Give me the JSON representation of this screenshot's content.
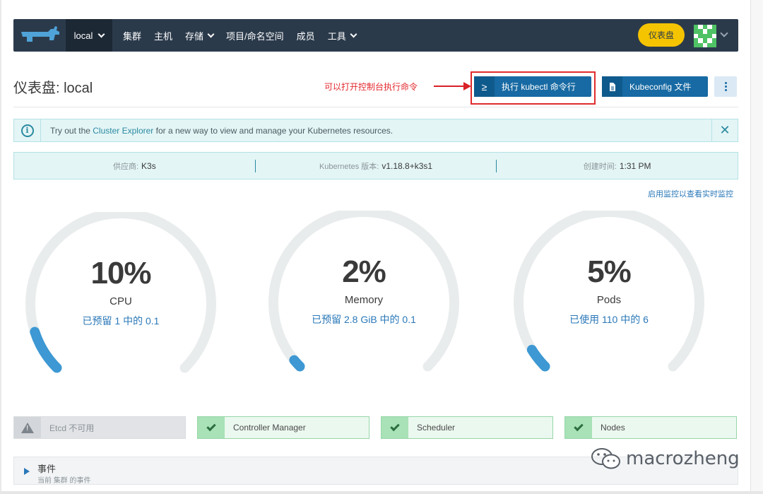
{
  "header": {
    "cluster": "local",
    "nav": [
      "集群",
      "主机",
      "存储",
      "项目/命名空间",
      "成员",
      "工具"
    ],
    "dashboard_button": "仪表盘"
  },
  "page": {
    "title": "仪表盘: local",
    "annotation": "可以打开控制台执行命令",
    "kubectl_button": "执行 kubectl 命令行",
    "kubeconfig_button": "Kubeconfig 文件"
  },
  "banner": {
    "before": "Try out the ",
    "link": "Cluster Explorer",
    "after": " for a new way to view and manage your Kubernetes resources."
  },
  "info": {
    "provider_label": "供应商:",
    "provider_value": "K3s",
    "k8s_label": "Kubernetes 版本:",
    "k8s_value": "v1.18.8+k3s1",
    "created_label": "创建时间:",
    "created_value": "1:31 PM"
  },
  "monitor_link": "启用监控以查看实时监控",
  "gauges": [
    {
      "percent_label": "10%",
      "name": "CPU",
      "detail": "已预留 1 中的 0.1",
      "fraction": 0.1
    },
    {
      "percent_label": "2%",
      "name": "Memory",
      "detail": "已预留 2.8 GiB 中的 0.1",
      "fraction": 0.02
    },
    {
      "percent_label": "5%",
      "name": "Pods",
      "detail": "已使用 110 中的 6",
      "fraction": 0.05
    }
  ],
  "components": [
    {
      "name": "Etcd 不可用",
      "status": "unavailable"
    },
    {
      "name": "Controller Manager",
      "status": "ok"
    },
    {
      "name": "Scheduler",
      "status": "ok"
    },
    {
      "name": "Nodes",
      "status": "ok"
    }
  ],
  "events": {
    "title": "事件",
    "subtitle": "当前 集群 的事件"
  },
  "watermark": "macrozheng",
  "colors": {
    "header_bg": "#2b3a4b",
    "accent_blue": "#176aa3",
    "gauge_track": "#e9eced",
    "gauge_fill": "#3d98d3",
    "dashboard_yellow": "#f5c400",
    "ok_green": "#a8e2b6"
  }
}
